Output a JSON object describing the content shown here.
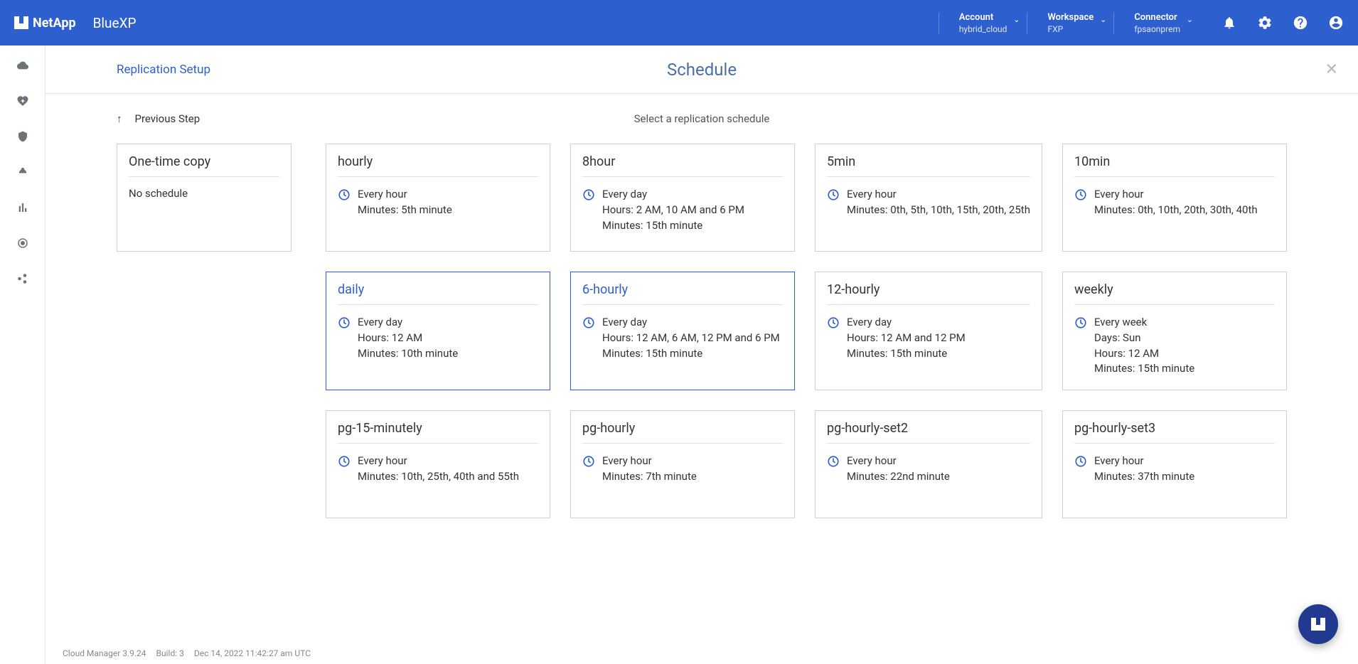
{
  "topbar": {
    "logo_text": "NetApp",
    "product": "BlueXP",
    "account": {
      "label": "Account",
      "value": "hybrid_cloud"
    },
    "workspace": {
      "label": "Workspace",
      "value": "FXP"
    },
    "connector": {
      "label": "Connector",
      "value": "fpsaonprem"
    }
  },
  "subheader": {
    "breadcrumb": "Replication Setup",
    "title": "Schedule"
  },
  "toprow": {
    "prev": "Previous Step",
    "instruction": "Select a replication schedule"
  },
  "onetime": {
    "title": "One-time copy",
    "text": "No schedule"
  },
  "cards": [
    {
      "title": "hourly",
      "selected": false,
      "lines": [
        "Every hour",
        "Minutes: 5th minute"
      ]
    },
    {
      "title": "8hour",
      "selected": false,
      "lines": [
        "Every day",
        "Hours: 2 AM, 10 AM and 6 PM",
        "Minutes: 15th minute"
      ]
    },
    {
      "title": "5min",
      "selected": false,
      "lines": [
        "Every hour",
        "Minutes: 0th, 5th, 10th, 15th, 20th, 25th"
      ]
    },
    {
      "title": "10min",
      "selected": false,
      "lines": [
        "Every hour",
        "Minutes: 0th, 10th, 20th, 30th, 40th"
      ]
    },
    {
      "title": "daily",
      "selected": true,
      "lines": [
        "Every day",
        "Hours: 12 AM",
        "Minutes: 10th minute"
      ]
    },
    {
      "title": "6-hourly",
      "selected": true,
      "lines": [
        "Every day",
        "Hours: 12 AM, 6 AM, 12 PM and 6 PM",
        "Minutes: 15th minute"
      ]
    },
    {
      "title": "12-hourly",
      "selected": false,
      "lines": [
        "Every day",
        "Hours: 12 AM and 12 PM",
        "Minutes: 15th minute"
      ]
    },
    {
      "title": "weekly",
      "selected": false,
      "lines": [
        "Every week",
        "Days: Sun",
        "Hours: 12 AM",
        "Minutes: 15th minute"
      ]
    },
    {
      "title": "pg-15-minutely",
      "selected": false,
      "lines": [
        "Every hour",
        "Minutes: 10th, 25th, 40th and 55th"
      ]
    },
    {
      "title": "pg-hourly",
      "selected": false,
      "lines": [
        "Every hour",
        "Minutes: 7th minute"
      ]
    },
    {
      "title": "pg-hourly-set2",
      "selected": false,
      "lines": [
        "Every hour",
        "Minutes: 22nd minute"
      ]
    },
    {
      "title": "pg-hourly-set3",
      "selected": false,
      "lines": [
        "Every hour",
        "Minutes: 37th minute"
      ]
    }
  ],
  "footer": {
    "version": "Cloud Manager 3.9.24",
    "build": "Build: 3",
    "date": "Dec 14, 2022 11:42:27 am UTC"
  }
}
